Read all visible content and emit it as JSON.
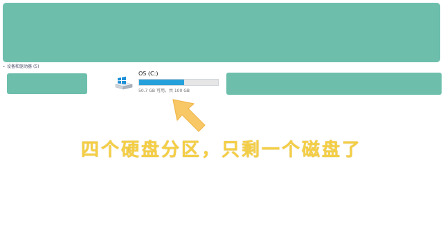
{
  "section": {
    "title": "设备和驱动器 (5)",
    "collapse_glyph": "⌄"
  },
  "drive": {
    "name": "OS (C:)",
    "meta": "50.7 GB 可用，共 100 GB",
    "used_fraction": 0.57,
    "bar_color": "#26a0da",
    "icon": "windows-drive-icon"
  },
  "annotation": {
    "caption": "四个硬盘分区，只剩一个磁盘了",
    "caption_color": "#f4cf45",
    "arrow_color": "#f8c766"
  },
  "redaction_color": "#6dbfac"
}
